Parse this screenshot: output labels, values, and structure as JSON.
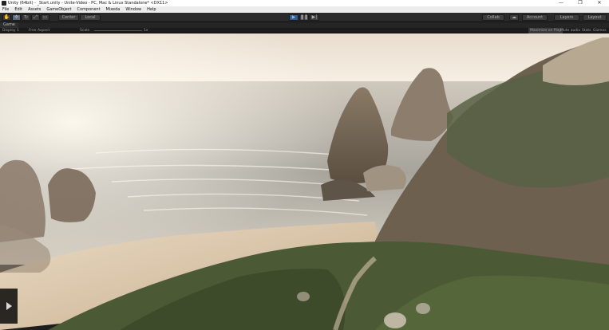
{
  "window": {
    "title": "Unity (64bit) - _Start.unity - Unite-Video - PC, Mac & Linux Standalone* <DX11>",
    "controls": [
      "—",
      "❐",
      "✕"
    ]
  },
  "menu": [
    "File",
    "Edit",
    "Assets",
    "GameObject",
    "Component",
    "Mixeda",
    "Window",
    "Help"
  ],
  "toolbar": {
    "pivot_label": "Center",
    "local_label": "Local",
    "account_label": "Account",
    "layers_label": "Layers",
    "layout_label": "Layout",
    "collab_label": "Collab"
  },
  "game_view": {
    "tab_label": "Game",
    "display_label": "Display 1",
    "aspect_label": "Free Aspect",
    "scale_label": "Scale",
    "scale_value": "1x",
    "options": [
      "Maximize on Play",
      "Mute audio",
      "Stats",
      "Gizmos"
    ]
  },
  "colors": {
    "sky": "#f2e9dc",
    "sea": "#b9b4aa",
    "cliff_green": "#4a5a36",
    "rock": "#7d6e5d",
    "toolbar_bg": "#2a2a2a",
    "play_accent": "#2d5a99"
  }
}
